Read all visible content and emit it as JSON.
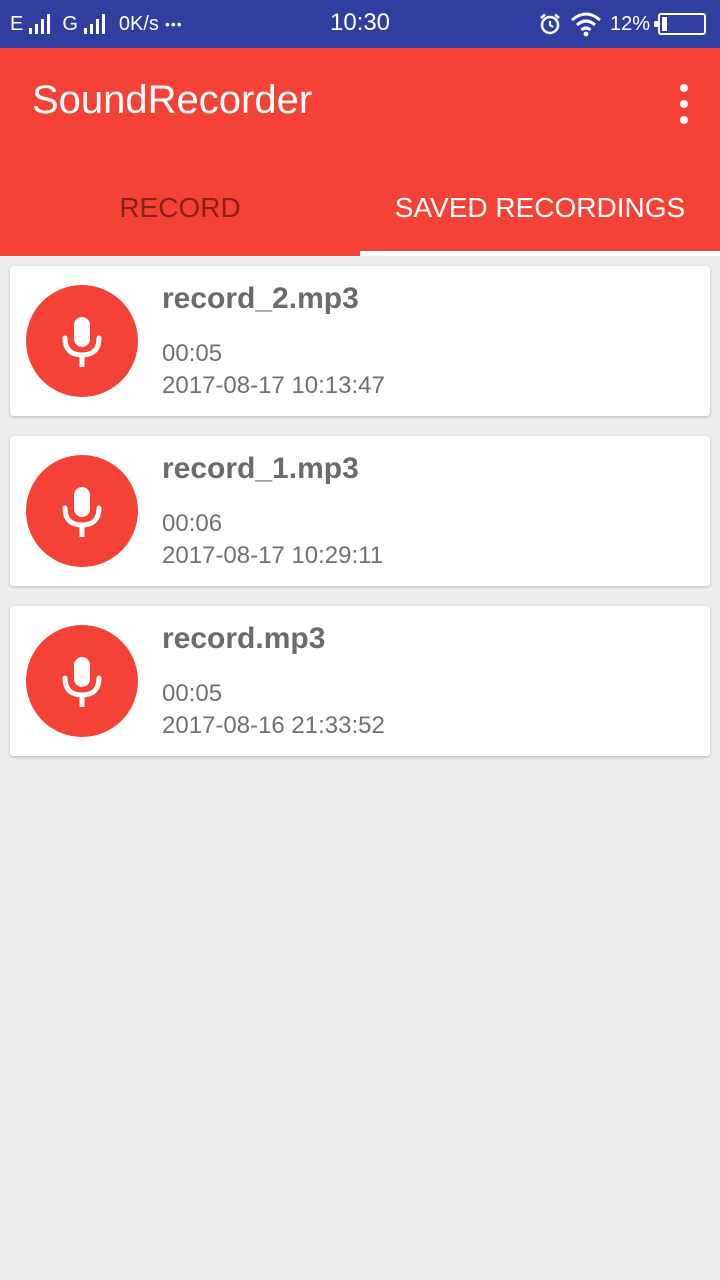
{
  "status_bar": {
    "network1": "E",
    "network2": "G",
    "speed": "0K/s",
    "dots": "•••",
    "time": "10:30",
    "battery": "12%",
    "battery_level": 0.12
  },
  "app_bar": {
    "title": "SoundRecorder",
    "color": "#f44336"
  },
  "tabs": [
    {
      "label": "RECORD",
      "active": false
    },
    {
      "label": "SAVED RECORDINGS",
      "active": true
    }
  ],
  "recordings": [
    {
      "name": "record_2.mp3",
      "duration": "00:05",
      "date": "2017-08-17 10:13:47"
    },
    {
      "name": "record_1.mp3",
      "duration": "00:06",
      "date": "2017-08-17 10:29:11"
    },
    {
      "name": "record.mp3",
      "duration": "00:05",
      "date": "2017-08-16 21:33:52"
    }
  ],
  "icons": {
    "mic": "microphone-icon",
    "alarm": "alarm-clock-icon",
    "wifi": "wifi-icon",
    "overflow": "more-vert-icon"
  }
}
